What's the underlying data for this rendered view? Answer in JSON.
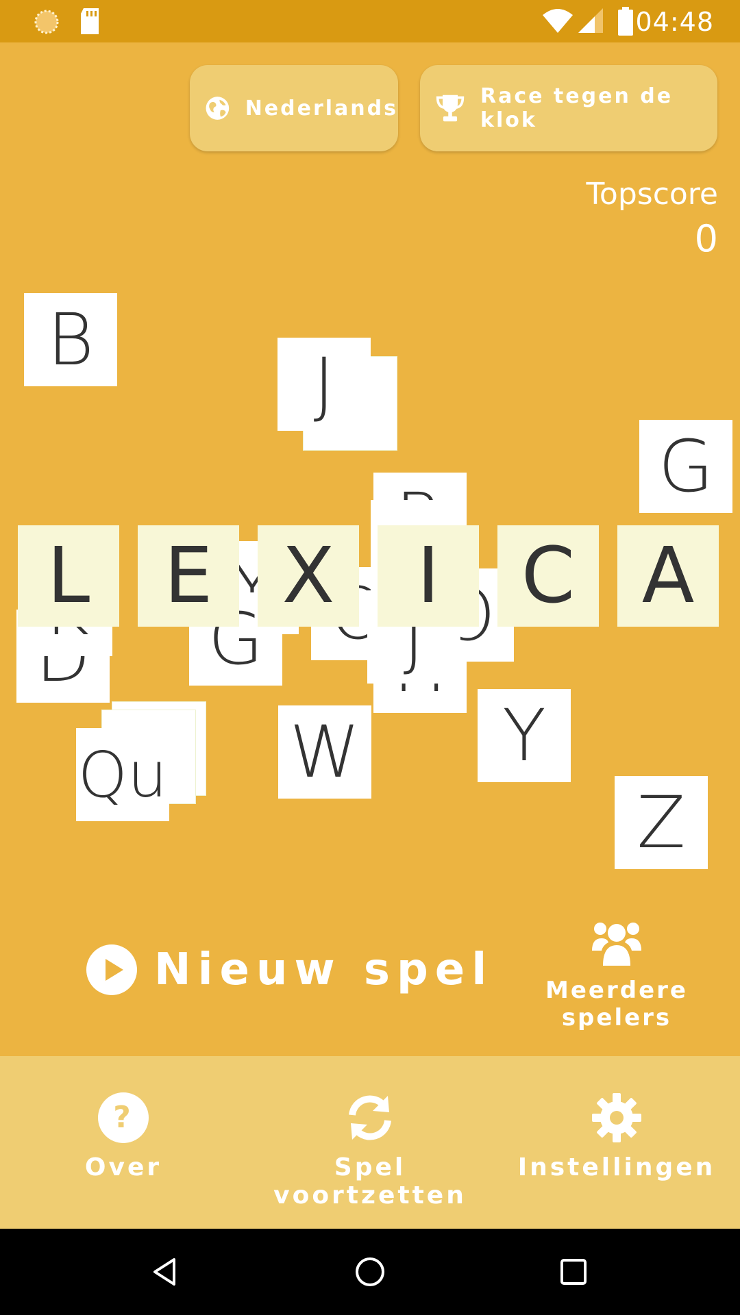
{
  "status_bar": {
    "time": "04:48"
  },
  "header": {
    "language_label": "Nederlands",
    "mode_label": "Race tegen de klok"
  },
  "topscore": {
    "label": "Topscore",
    "value": "0"
  },
  "tiles": [
    "B",
    "J",
    "G",
    "Z",
    "Y",
    "W",
    "Qu",
    "D",
    "G",
    "R",
    "Y",
    "J",
    "H",
    "O",
    "O",
    "K"
  ],
  "logo_letters": [
    "L",
    "E",
    "X",
    "I",
    "C",
    "A"
  ],
  "actions": {
    "new_game": "Nieuw spel",
    "multiplayer": "Meerdere spelers"
  },
  "bottom_nav": {
    "about": "Over",
    "continue": "Spel voortzetten",
    "settings": "Instellingen"
  },
  "colors": {
    "background": "#ecb441",
    "status_bar": "#d99a12",
    "panel": "#efcd72",
    "tile": "#ffffff",
    "logo_tile": "#f8f7d7"
  }
}
